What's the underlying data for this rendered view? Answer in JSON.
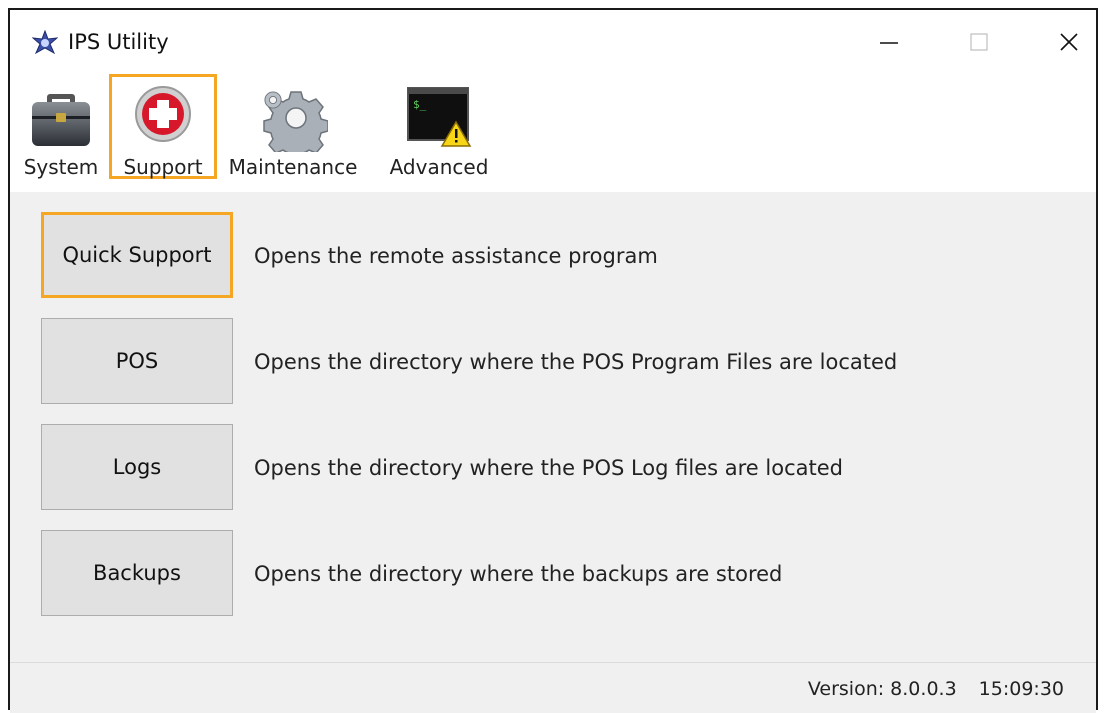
{
  "window": {
    "title": "IPS Utility"
  },
  "toolbar": {
    "items": [
      {
        "label": "System",
        "icon": "briefcase-icon"
      },
      {
        "label": "Support",
        "icon": "medical-cross-icon",
        "selected": true
      },
      {
        "label": "Maintenance",
        "icon": "gear-icon"
      },
      {
        "label": "Advanced",
        "icon": "terminal-warning-icon"
      }
    ]
  },
  "actions": [
    {
      "button": "Quick Support",
      "description": "Opens the remote assistance program",
      "focused": true
    },
    {
      "button": "POS",
      "description": "Opens the directory where the POS Program Files are located"
    },
    {
      "button": "Logs",
      "description": "Opens the directory where the POS Log files are located"
    },
    {
      "button": "Backups",
      "description": "Opens the directory where the backups are stored"
    }
  ],
  "status": {
    "version": "Version: 8.0.0.3",
    "time": "15:09:30"
  },
  "colors": {
    "highlight": "#f5a623",
    "background": "#f0f0f0",
    "button": "#e1e1e1"
  }
}
